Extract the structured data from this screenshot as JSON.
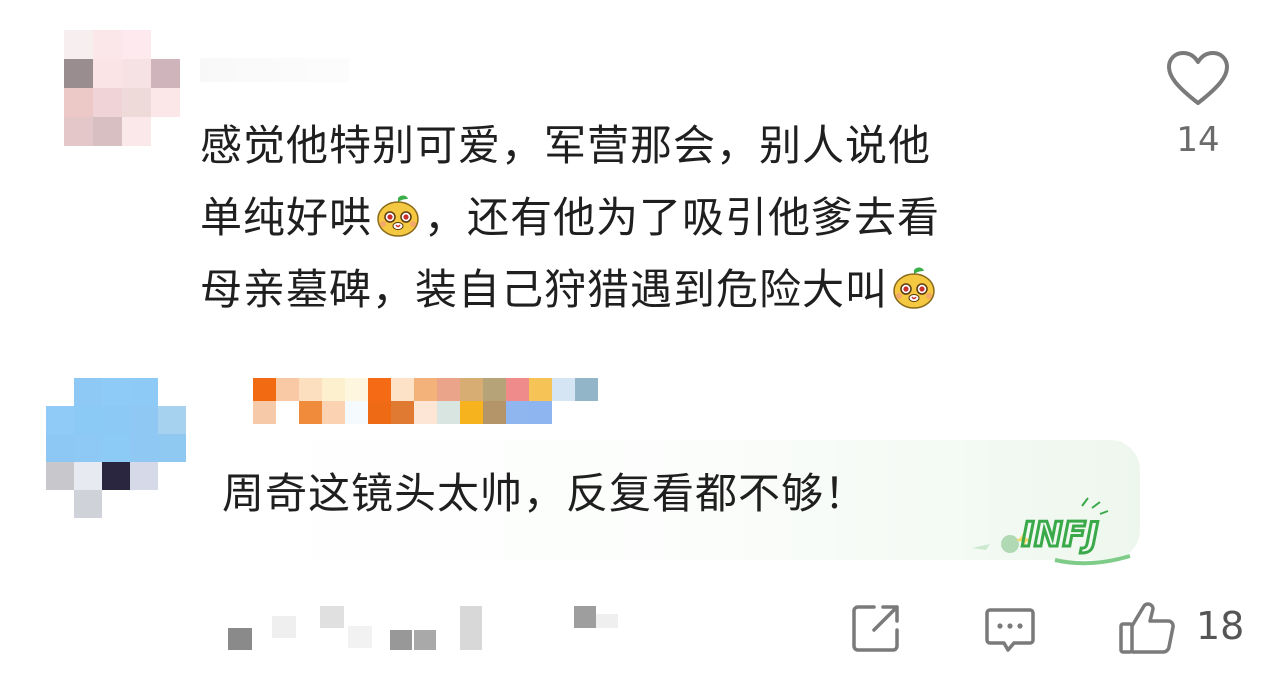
{
  "comments": [
    {
      "text_lines": [
        "感觉他特别可爱，军营那会，别人说他",
        "单纯好哄",
        "，还有他为了吸引他爹去看",
        "母亲墓碑，装自己狩猎遇到危险大叫"
      ],
      "emoji": "mango-face-emoji",
      "likes": "14"
    },
    {
      "text": "周奇这镜头太帅，反复看都不够！",
      "badge_text": "INFJ",
      "share_label": "",
      "reply_label": "",
      "likes": "18"
    }
  ],
  "colors": {
    "text": "#1f1f1f",
    "count": "#6b6b6b",
    "icon": "#7a7a7a",
    "badge_green": "#3aa94a"
  }
}
